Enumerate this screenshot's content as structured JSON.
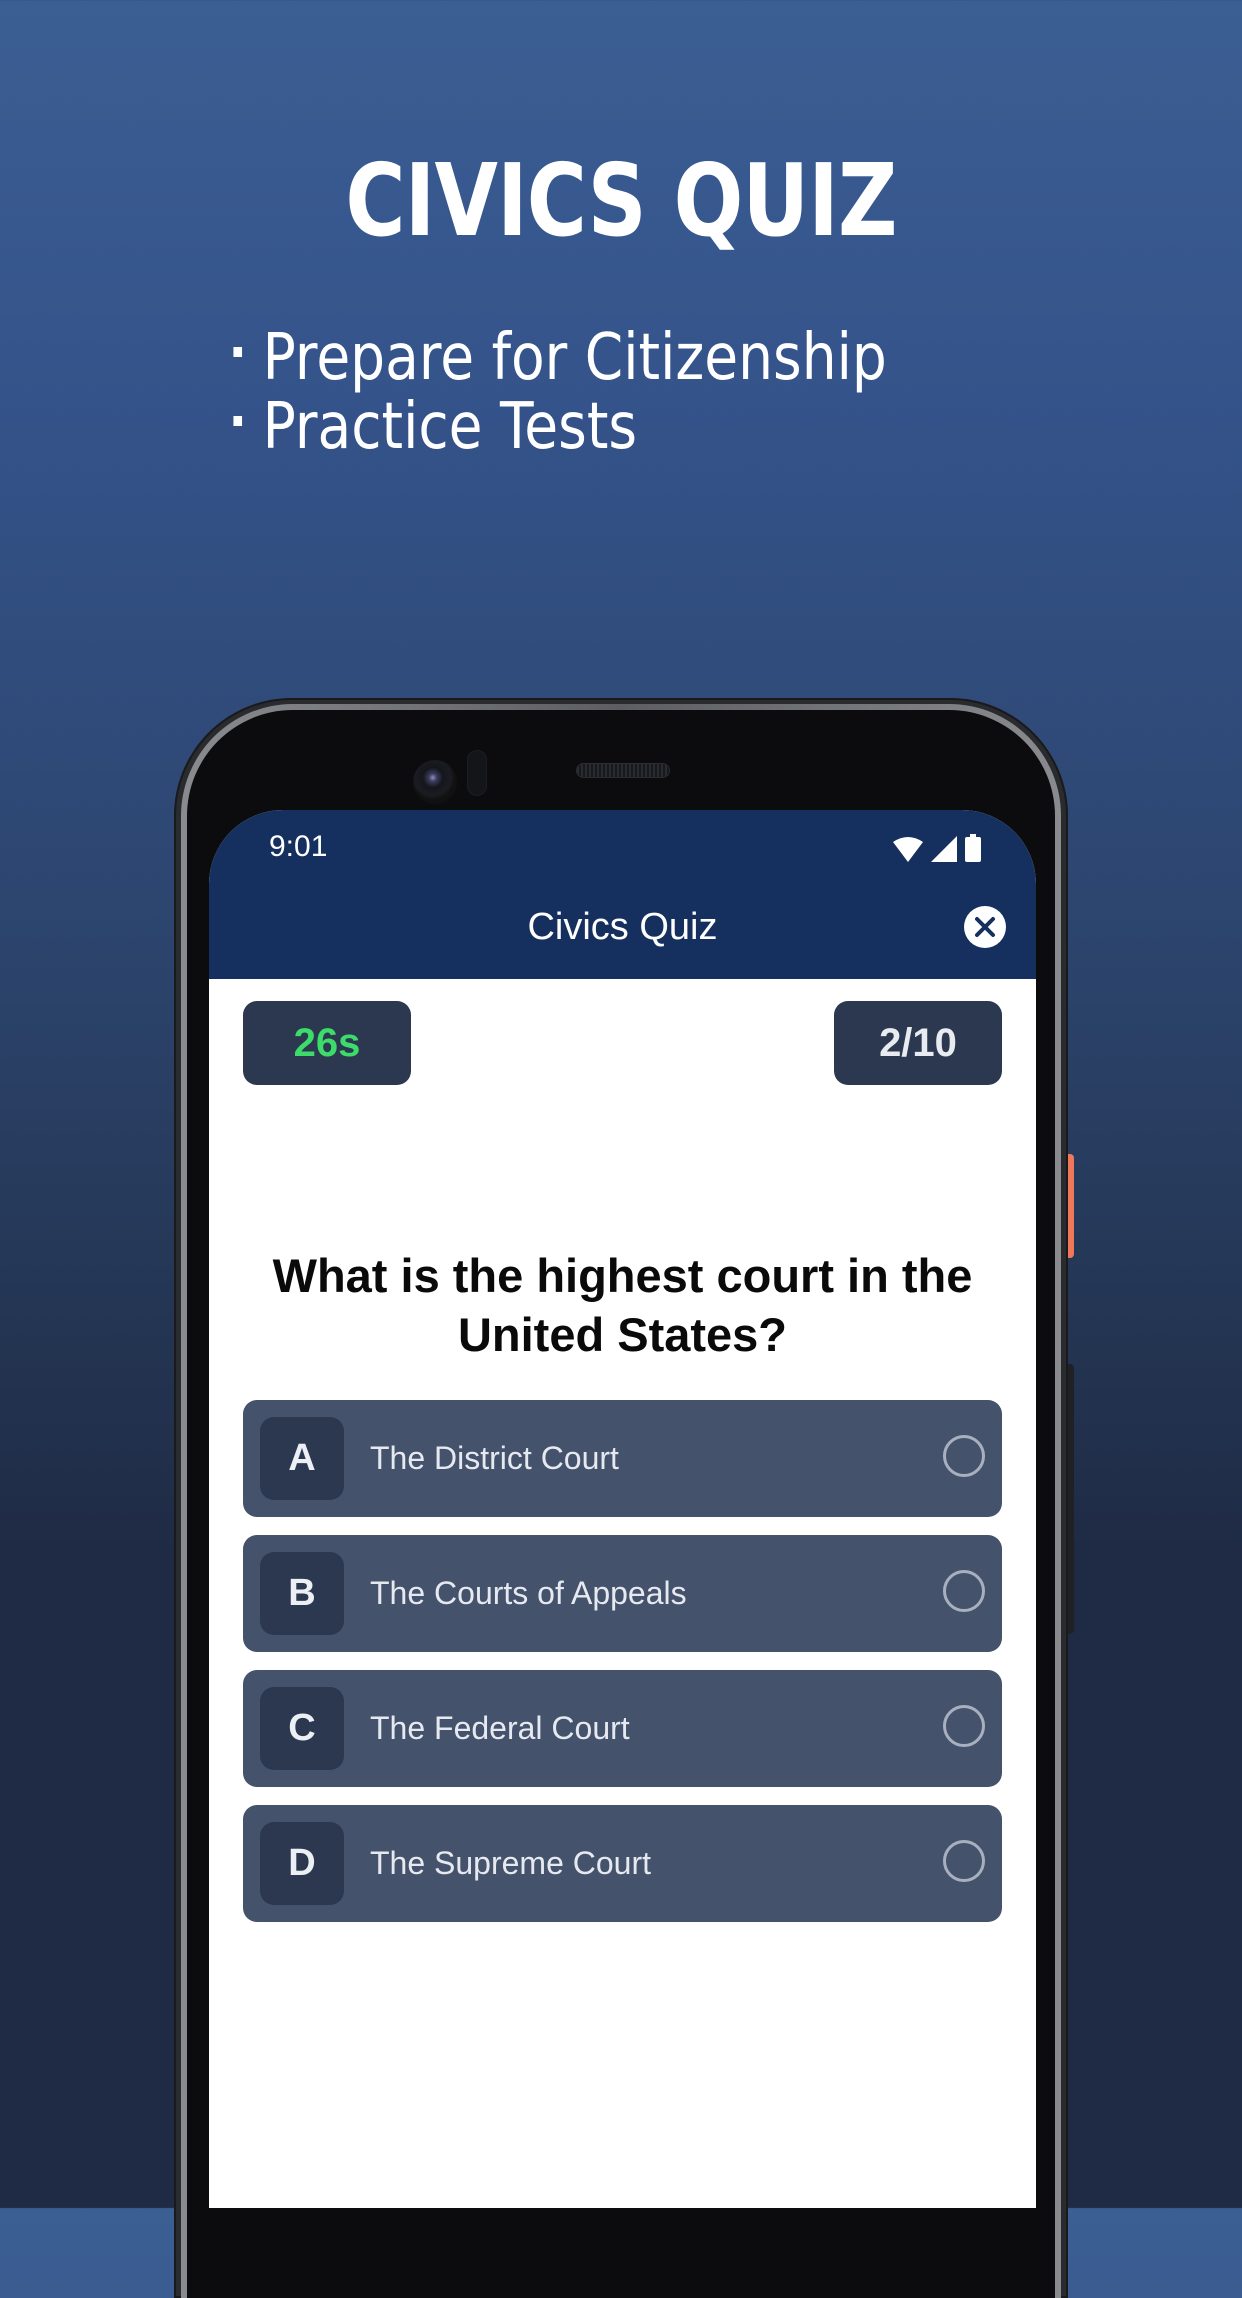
{
  "promo": {
    "title": "CIVICS QUIZ",
    "bullets": [
      "Prepare for Citizenship",
      "Practice Tests"
    ]
  },
  "status_bar": {
    "time": "9:01",
    "icons": [
      "wifi-icon",
      "signal-icon",
      "battery-icon"
    ]
  },
  "app_bar": {
    "title": "Civics Quiz",
    "close_icon": "close-icon"
  },
  "quiz": {
    "timer": "26s",
    "progress": "2/10",
    "progress_current": 2,
    "progress_total": 10,
    "question": "What is the highest court in the United States?",
    "options": [
      {
        "letter": "A",
        "text": "The District Court",
        "selected": false
      },
      {
        "letter": "B",
        "text": "The Courts of Appeals",
        "selected": false
      },
      {
        "letter": "C",
        "text": "The Federal Court",
        "selected": false
      },
      {
        "letter": "D",
        "text": "The Supreme Court",
        "selected": false
      }
    ]
  },
  "colors": {
    "background_top": "#3b5e93",
    "background_bottom": "#1f2b45",
    "app_bar": "#15305f",
    "pill": "#2b3850",
    "timer_text": "#3ddc6a",
    "option_bg": "#44526c",
    "power_button": "#f0785a"
  }
}
